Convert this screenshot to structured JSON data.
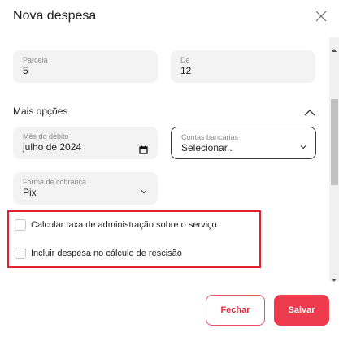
{
  "modal": {
    "title": "Nova despesa"
  },
  "fields": {
    "parcela": {
      "label": "Parcela",
      "value": "5"
    },
    "de": {
      "label": "De",
      "value": "12"
    }
  },
  "more_options": {
    "title": "Mais opções",
    "mes_debito": {
      "label": "Mês do débito",
      "value": "julho de 2024"
    },
    "contas": {
      "label": "Contas bancárias",
      "value": "Selecionar.."
    },
    "forma_cobranca": {
      "label": "Forma de cobrança",
      "value": "Pix"
    }
  },
  "checkboxes": [
    {
      "label": "Calcular taxa de administração sobre o serviço",
      "checked": false
    },
    {
      "label": "Incluir despesa no cálculo de rescisão",
      "checked": false
    }
  ],
  "buttons": {
    "cancel": "Fechar",
    "save": "Salvar"
  },
  "colors": {
    "accent": "#ee3a4d",
    "highlight": "#e3202e"
  },
  "icons": [
    "close-icon",
    "chevron-up-icon",
    "chevron-down-icon",
    "calendar-icon"
  ]
}
